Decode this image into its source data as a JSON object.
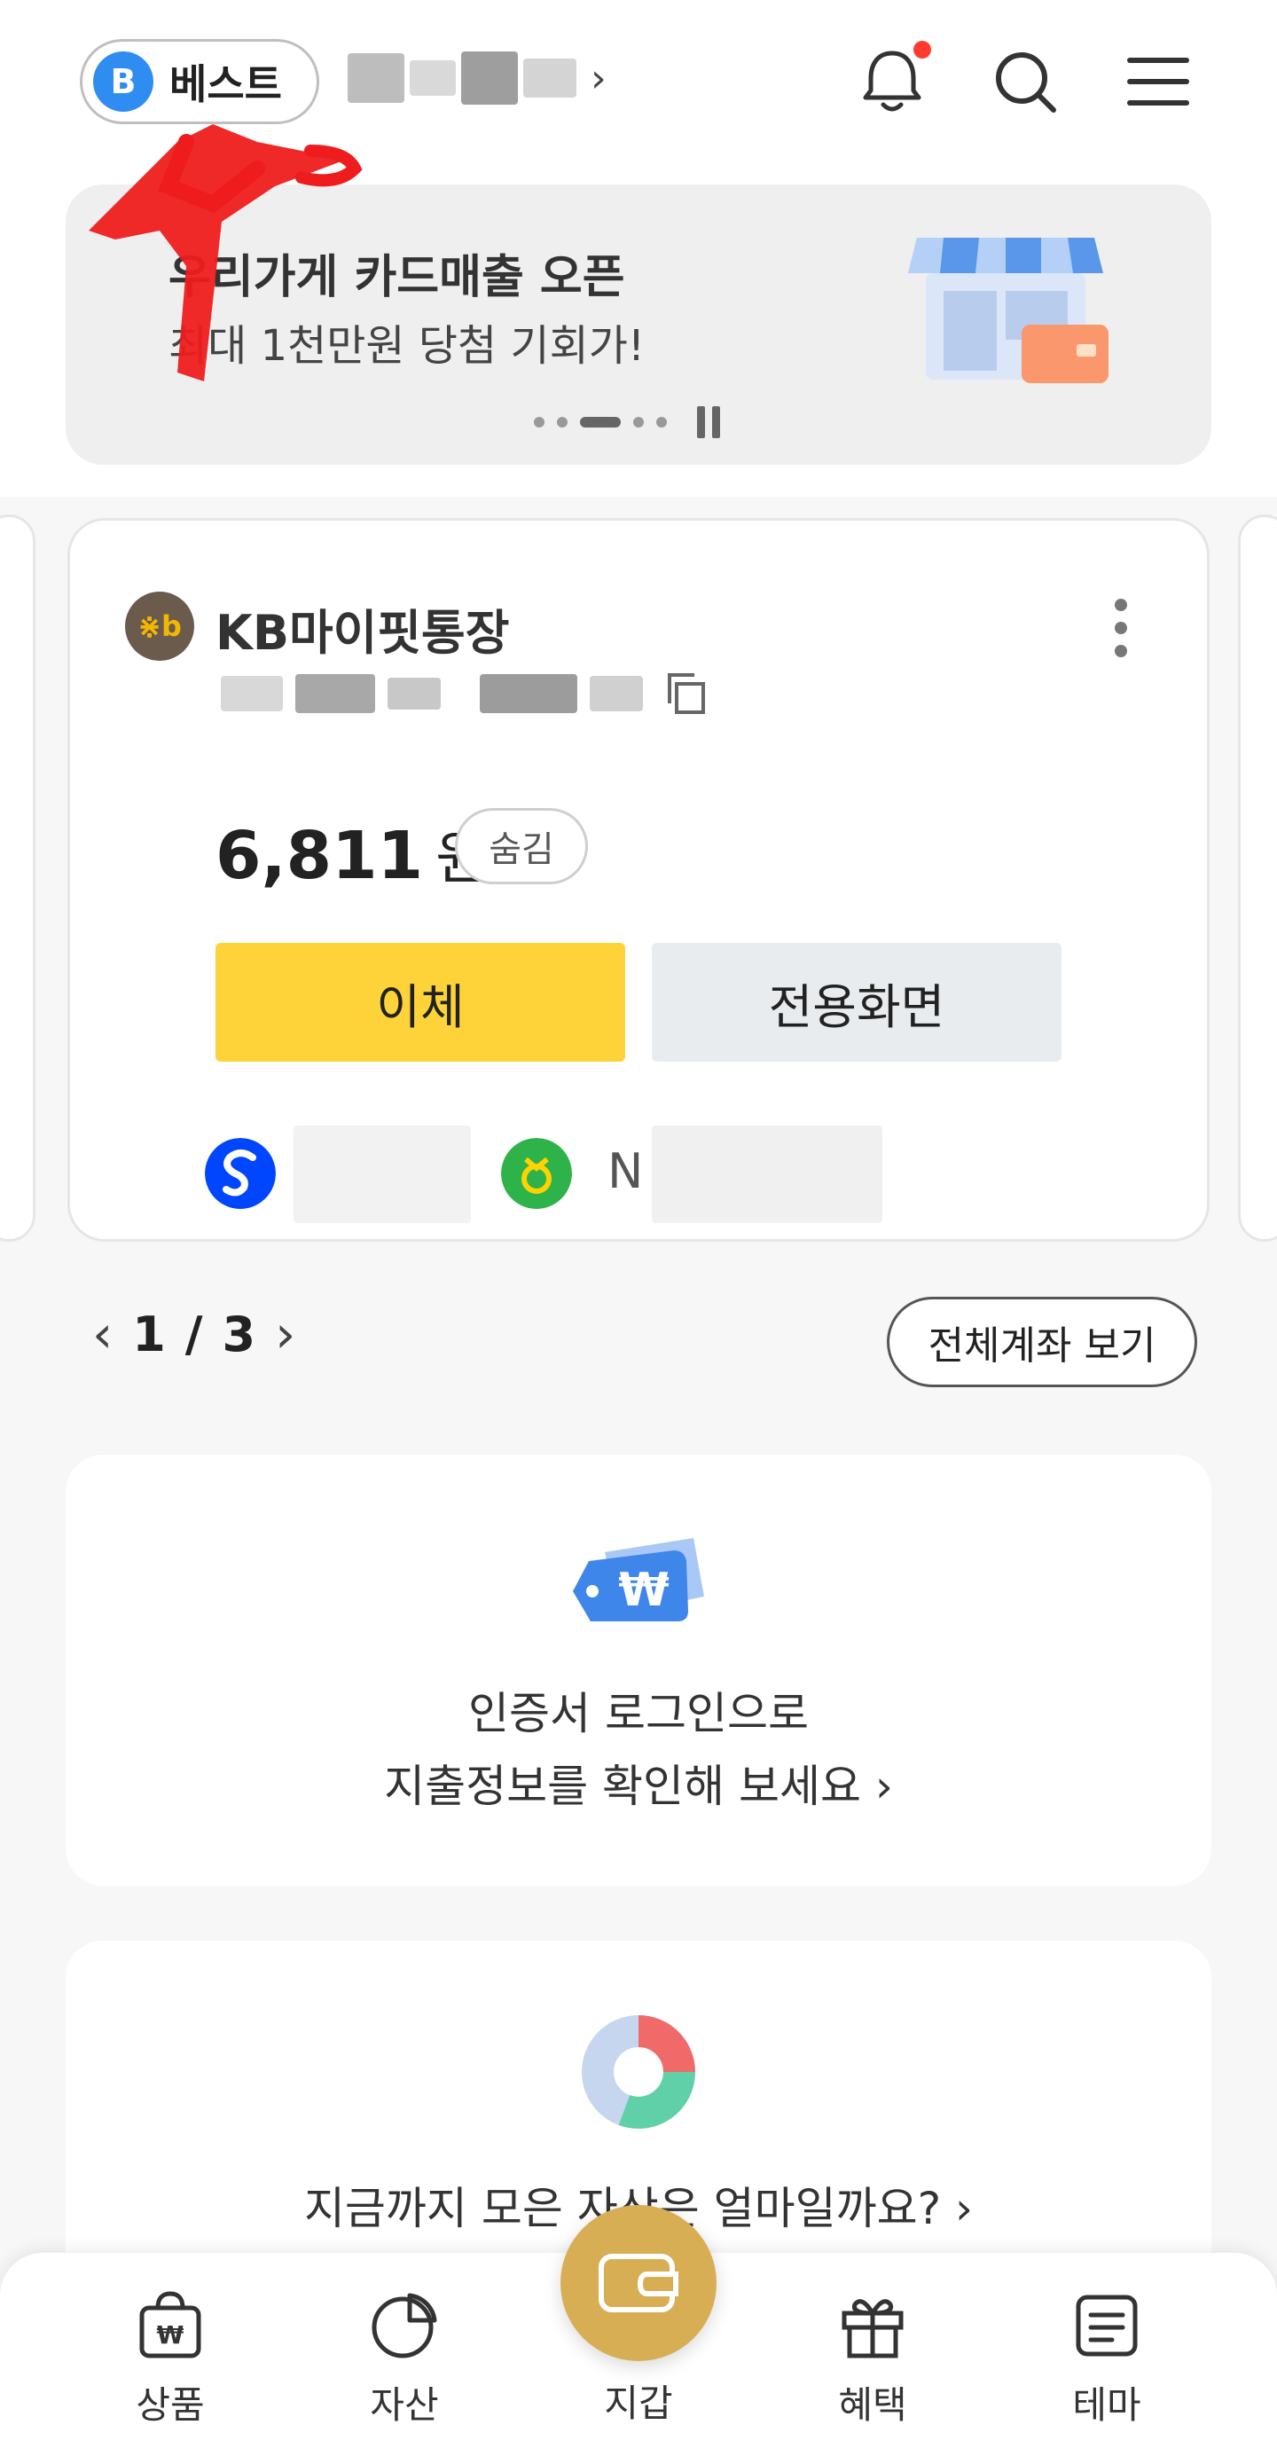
{
  "header": {
    "grade_badge_letter": "B",
    "grade_label": "베스트",
    "user_name_chevron": "›"
  },
  "banner": {
    "title": "우리가게 카드매출 오픈",
    "subtitle": "최대 1천만원 당첨 기회가!",
    "current_slide": 3,
    "total_slides": 5
  },
  "account_card": {
    "bank_logo_text": "⋇b",
    "name": "KB마이핏통장",
    "balance": "6,811",
    "currency": "원",
    "hide_label": "숨김",
    "transfer_label": "이체",
    "dedicated_label": "전용화면",
    "linked_bank_text": "N"
  },
  "pager": {
    "current": "1",
    "separator": "/",
    "total": "3",
    "prev": "‹",
    "next": "›",
    "all_accounts_label": "전체계좌 보기"
  },
  "spending": {
    "line1": "인증서 로그인으로",
    "line2": "지출정보를 확인해 보세요 ›"
  },
  "assets": {
    "line": "지금까지 모은 자산은 얼마일까요? ›"
  },
  "bottom_nav": {
    "products": "상품",
    "assets": "자산",
    "wallet": "지갑",
    "benefits": "혜택",
    "theme": "테마"
  },
  "colors": {
    "accent_yellow": "#fdd339",
    "grade_blue": "#2f8df2",
    "notification_red": "#ff3b30",
    "wallet_gold": "#d8ae55"
  }
}
